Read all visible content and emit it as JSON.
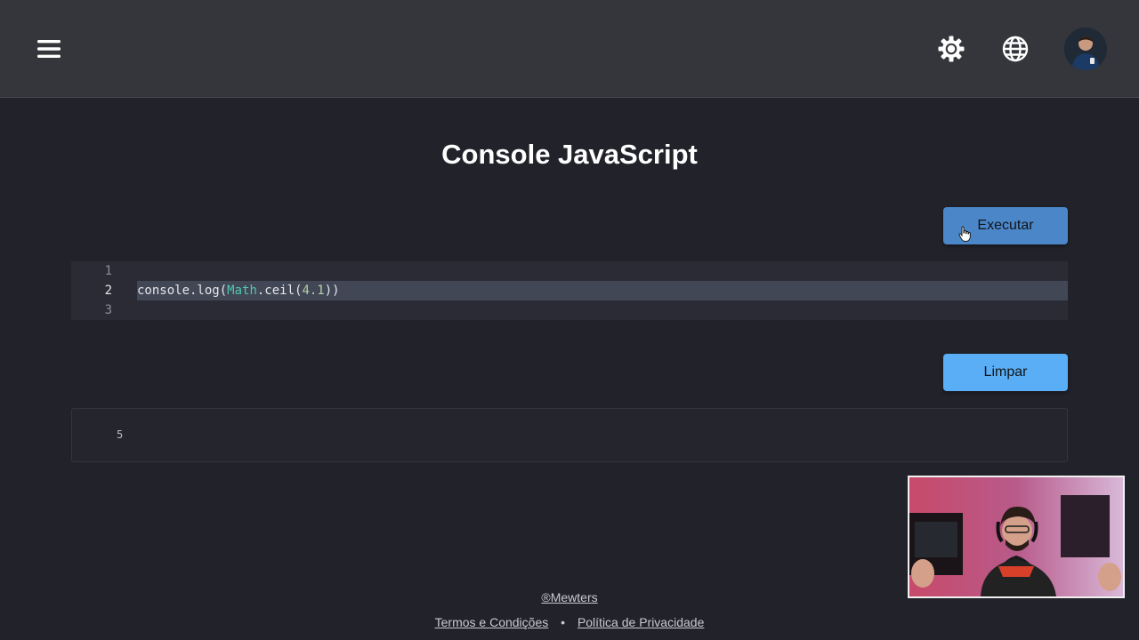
{
  "header": {
    "menu_icon": "hamburger-menu-icon",
    "settings_icon": "gear-icon",
    "language_icon": "globe-icon",
    "avatar": "user-avatar"
  },
  "main": {
    "title": "Console JavaScript",
    "run_label": "Executar",
    "clear_label": "Limpar"
  },
  "editor": {
    "lines": [
      {
        "number": "1",
        "code": ""
      },
      {
        "number": "2",
        "code": "console.log(Math.ceil(4.1))"
      },
      {
        "number": "3",
        "code": ""
      }
    ],
    "active_line": 2
  },
  "output": {
    "lines": [
      "5"
    ]
  },
  "footer": {
    "brand": "®Mewters",
    "terms": "Termos e Condições",
    "separator": "•",
    "privacy": "Política de Privacidade"
  },
  "colors": {
    "background": "#22222b",
    "topbar": "#34363b",
    "run_button": "#4a86c8",
    "clear_button": "#5aaef5",
    "token_class": "#4ec9b0",
    "token_number": "#b5cea8"
  }
}
